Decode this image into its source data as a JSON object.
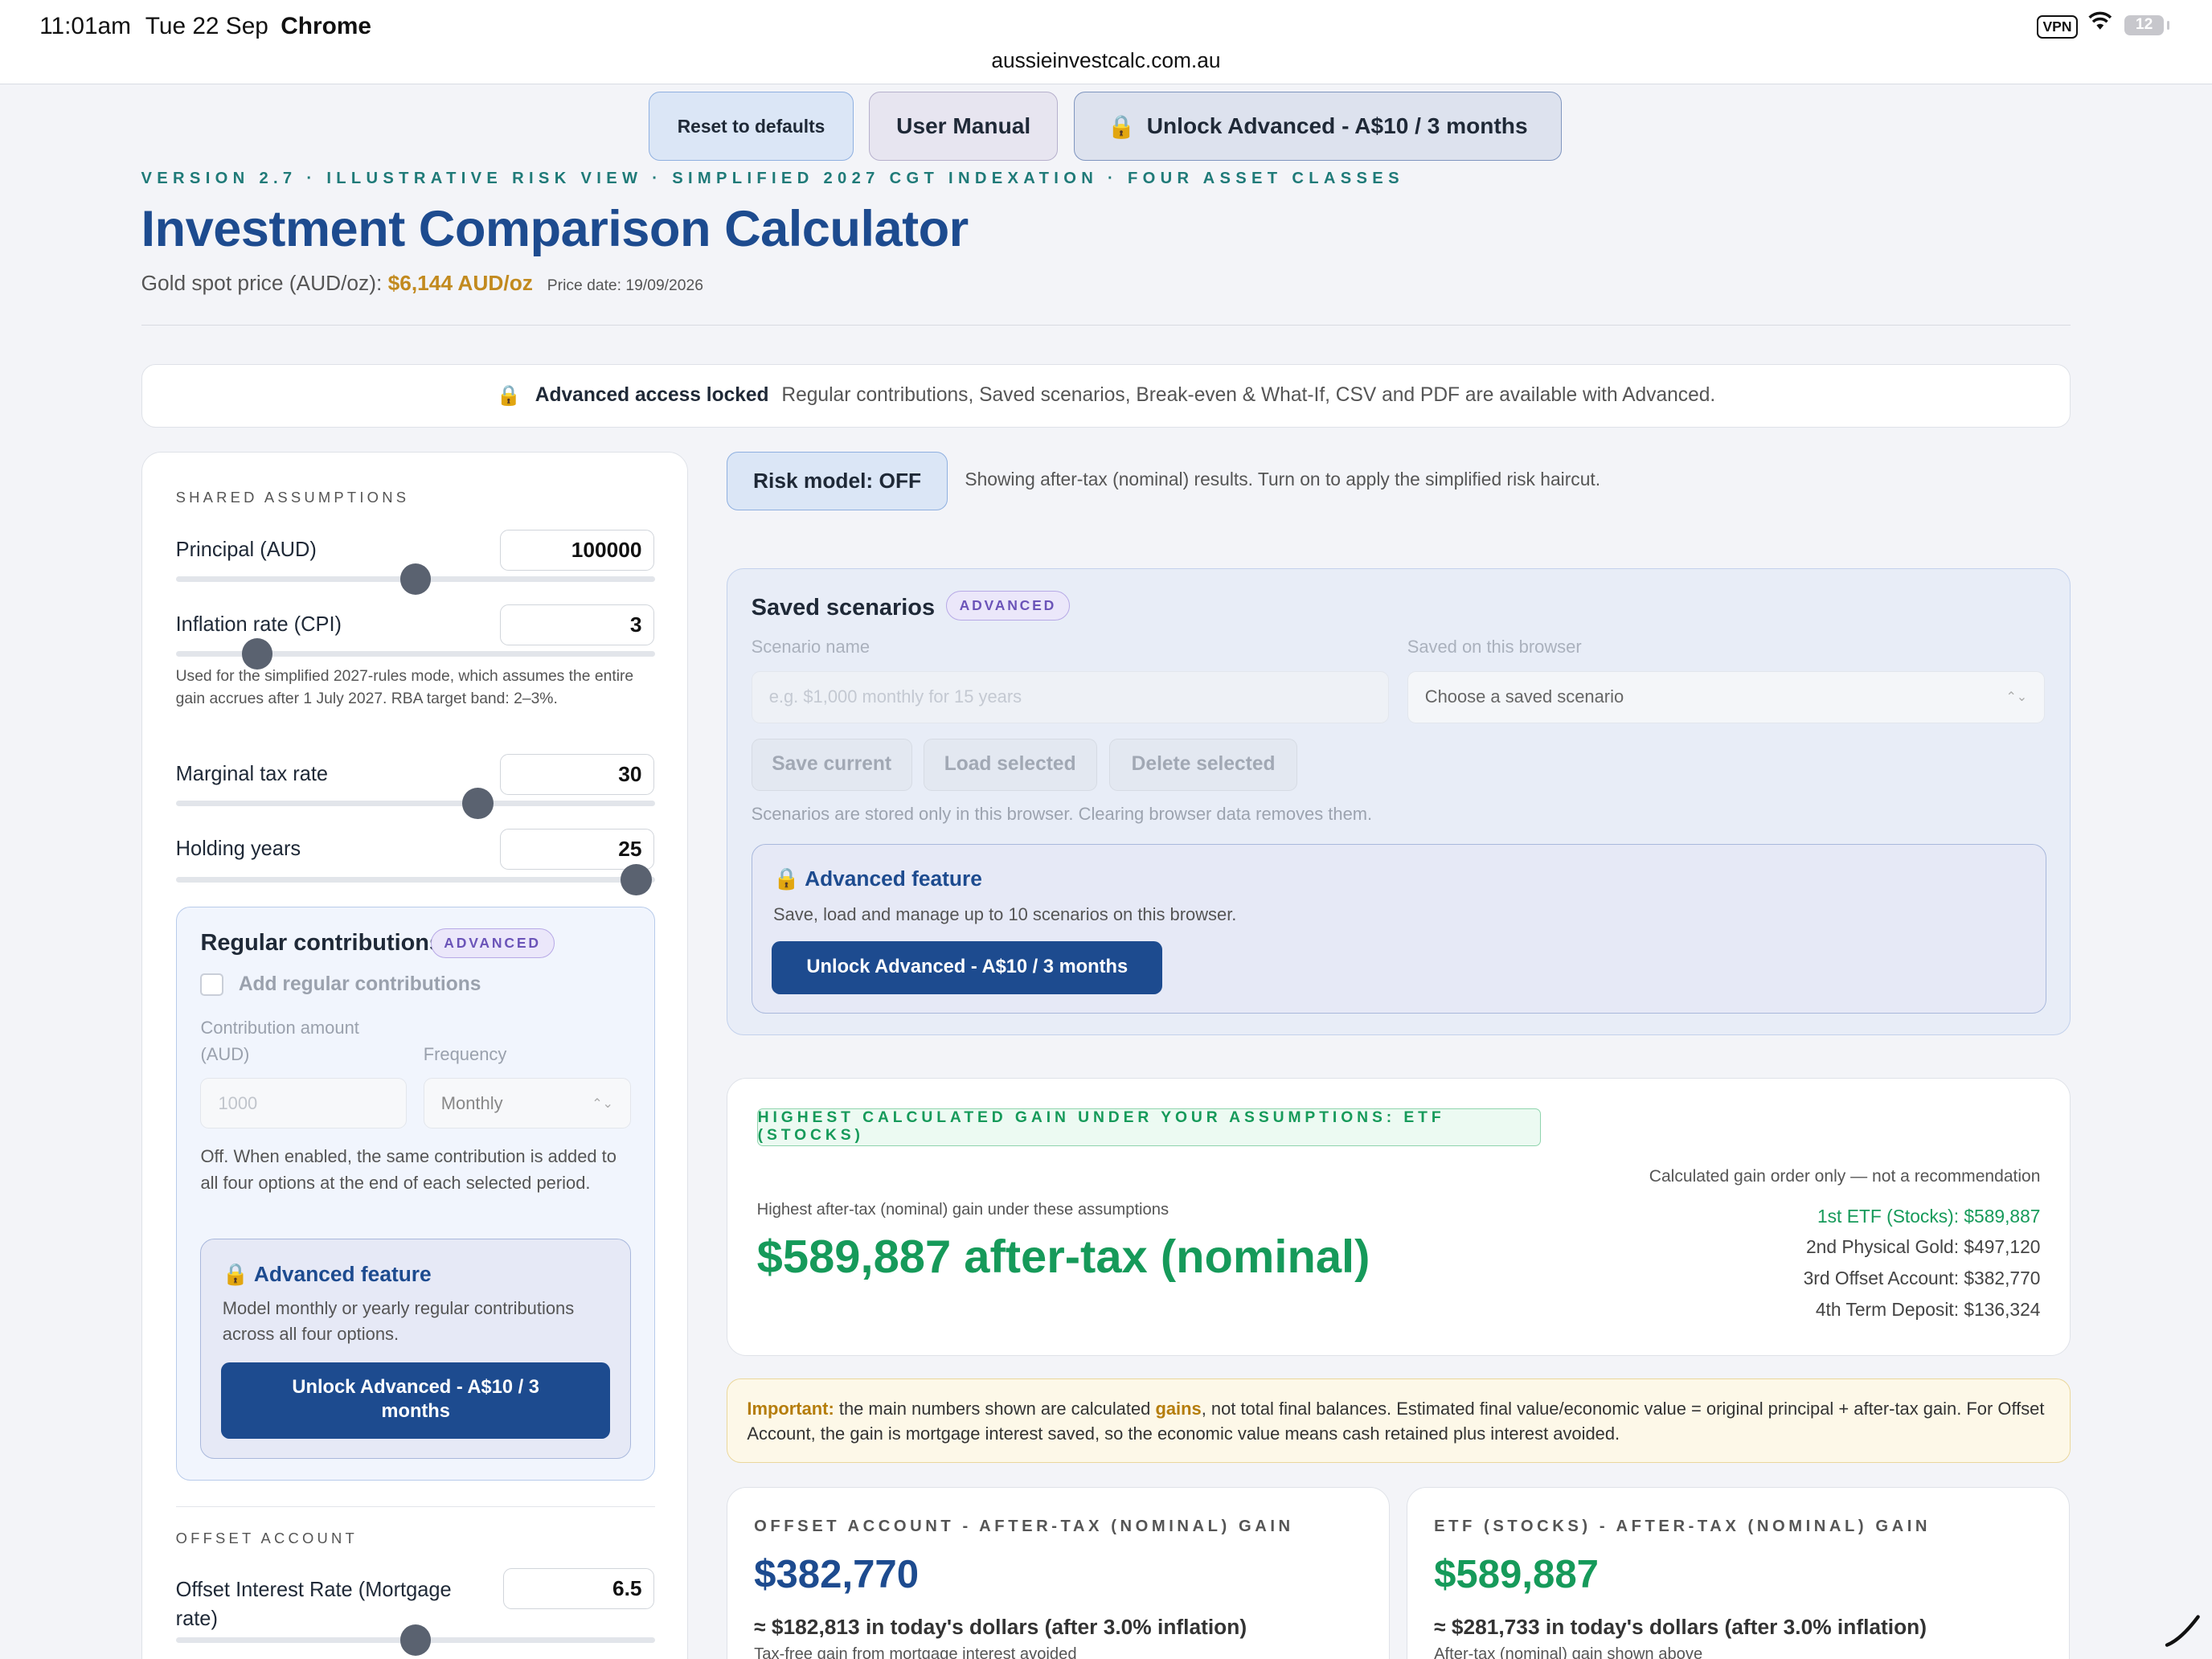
{
  "status_bar": {
    "time": "11:01am",
    "date": "Tue 22 Sep",
    "app": "Chrome",
    "url": "aussieinvestcalc.com.au",
    "vpn": "VPN",
    "battery": "12"
  },
  "top_buttons": {
    "reset": "Reset to defaults",
    "manual": "User Manual",
    "unlock": "Unlock Advanced - A$10 / 3 months"
  },
  "header": {
    "kicker": "VERSION 2.7 · ILLUSTRATIVE RISK VIEW · SIMPLIFIED 2027 CGT INDEXATION · FOUR ASSET CLASSES",
    "title": "Investment Comparison Calculator",
    "gold_label": "Gold spot price (AUD/oz):",
    "gold_price": "$6,144 AUD/oz",
    "price_date": "Price date: 19/09/2026"
  },
  "lock_bar": {
    "title": "Advanced access locked",
    "text": "Regular contributions, Saved scenarios, Break-even & What-If, CSV and PDF are available with Advanced."
  },
  "shared": {
    "section_label": "SHARED ASSUMPTIONS",
    "principal": {
      "label": "Principal (AUD)",
      "value": "100000",
      "slider": 0.5
    },
    "inflation": {
      "label": "Inflation rate (CPI)",
      "value": "3",
      "slider": 0.17
    },
    "inflation_help": "Used for the simplified 2027-rules mode, which assumes the entire gain accrues after 1 July 2027. RBA target band: 2–3%.",
    "tax": {
      "label": "Marginal tax rate",
      "value": "30",
      "slider": 0.63
    },
    "years": {
      "label": "Holding years",
      "value": "25",
      "slider": 0.96
    }
  },
  "contributions": {
    "title": "Regular contributions",
    "badge": "ADVANCED",
    "checkbox_label": "Add regular contributions",
    "amount_label_1": "Contribution amount",
    "amount_label_2": "(AUD)",
    "frequency_label": "Frequency",
    "amount_placeholder": "1000",
    "frequency_value": "Monthly",
    "description": "Off. When enabled, the same contribution is added to all four options at the end of each selected period.",
    "adv_title": "Advanced feature",
    "adv_desc": "Model monthly or yearly regular contributions across all four options.",
    "adv_button_1": "Unlock Advanced - A$10 / 3",
    "adv_button_2": "months"
  },
  "offset": {
    "section_label": "OFFSET ACCOUNT",
    "label_1": "Offset Interest Rate (Mortgage",
    "label_2": "rate)",
    "value": "6.5",
    "slider": 0.5
  },
  "risk": {
    "button": "Risk model: OFF",
    "note": "Showing after-tax (nominal) results. Turn on to apply the simplified risk haircut."
  },
  "saved_scenarios": {
    "title": "Saved scenarios",
    "badge": "ADVANCED",
    "name_label": "Scenario name",
    "name_placeholder": "e.g. $1,000 monthly for 15 years",
    "browser_label": "Saved on this browser",
    "select_value": "Choose a saved scenario",
    "save_btn": "Save current",
    "load_btn": "Load selected",
    "delete_btn": "Delete selected",
    "note": "Scenarios are stored only in this browser. Clearing browser data removes them.",
    "adv_title": "Advanced feature",
    "adv_desc": "Save, load and manage up to 10 scenarios on this browser.",
    "adv_button": "Unlock Advanced - A$10 / 3 months"
  },
  "result": {
    "winner_badge": "HIGHEST CALCULATED GAIN UNDER YOUR ASSUMPTIONS: ETF (STOCKS)",
    "order_note": "Calculated gain order only — not a recommendation",
    "rank_1": "1st ETF (Stocks): $589,887",
    "rank_2": "2nd Physical Gold: $497,120",
    "rank_3": "3rd Offset Account: $382,770",
    "rank_4": "4th Term Deposit: $136,324",
    "hi_label": "Highest after-tax (nominal) gain under these assumptions",
    "hi_value": "$589,887 after-tax (nominal)"
  },
  "important": {
    "label": "Important:",
    "text_1": " the main numbers shown are calculated ",
    "gains": "gains",
    "text_2": ", not total final balances. Estimated final value/economic value = original principal + after-tax gain. For Offset Account, the gain is mortgage interest saved, so the economic value means cash retained plus interest avoided."
  },
  "cards": {
    "offset": {
      "title": "OFFSET ACCOUNT - AFTER-TAX (NOMINAL) GAIN",
      "value": "$382,770",
      "sub": "≈ $182,813 in today's dollars (after 3.0% inflation)",
      "note": "Tax-free gain from mortgage interest avoided",
      "color": "#1d4b8f"
    },
    "etf": {
      "title": "ETF (STOCKS) - AFTER-TAX (NOMINAL) GAIN",
      "value": "$589,887",
      "sub": "≈ $281,733 in today's dollars (after 3.0% inflation)",
      "note": "After-tax (nominal) gain shown above",
      "color": "#169a5a"
    }
  },
  "icons": {
    "lock": "lock-icon",
    "wifi": "wifi-icon",
    "pen": "apple-pencil-icon"
  }
}
